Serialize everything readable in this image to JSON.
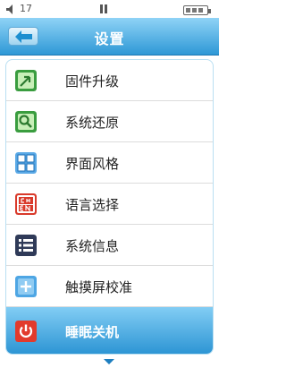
{
  "status_bar": {
    "volume_icon": "speaker-icon",
    "volume_level": "17",
    "playback_icon": "pause-icon",
    "battery_icon": "battery-icon",
    "battery_bars": 3
  },
  "header": {
    "back_icon": "back-arrow-icon",
    "title": "设置"
  },
  "menu": {
    "items": [
      {
        "label": "固件升级",
        "icon": "firmware-upgrade-icon",
        "selected": false
      },
      {
        "label": "系统还原",
        "icon": "system-restore-icon",
        "selected": false
      },
      {
        "label": "界面风格",
        "icon": "interface-style-icon",
        "selected": false
      },
      {
        "label": "语言选择",
        "icon": "language-select-icon",
        "selected": false
      },
      {
        "label": "系统信息",
        "icon": "system-info-icon",
        "selected": false
      },
      {
        "label": "触摸屏校准",
        "icon": "touchscreen-calibration-icon",
        "selected": false
      },
      {
        "label": "睡眠关机",
        "icon": "power-icon",
        "selected": true
      }
    ]
  },
  "scroll_indicator_icon": "chevron-down-icon",
  "colors": {
    "accent": "#2e98d6",
    "selected_bg": "#2a93d3"
  }
}
